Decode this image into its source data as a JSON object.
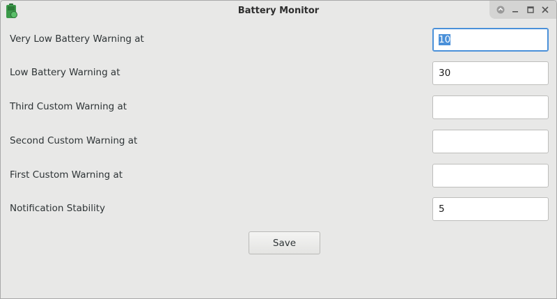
{
  "window": {
    "title": "Battery Monitor",
    "icon": "battery-icon",
    "controls": [
      "keep-above-icon",
      "minimize-icon",
      "maximize-icon",
      "close-icon"
    ]
  },
  "form": {
    "fields": [
      {
        "label": "Very Low Battery Warning at",
        "value": "10",
        "selected": true
      },
      {
        "label": "Low Battery Warning at",
        "value": "30"
      },
      {
        "label": "Third Custom Warning at",
        "value": ""
      },
      {
        "label": "Second Custom Warning at",
        "value": ""
      },
      {
        "label": "First Custom Warning at",
        "value": ""
      },
      {
        "label": "Notification Stability",
        "value": "5"
      }
    ],
    "save_label": "Save"
  },
  "colors": {
    "accent": "#4a90d9",
    "background": "#e8e8e7",
    "icon_green": "#3b9a4a"
  }
}
